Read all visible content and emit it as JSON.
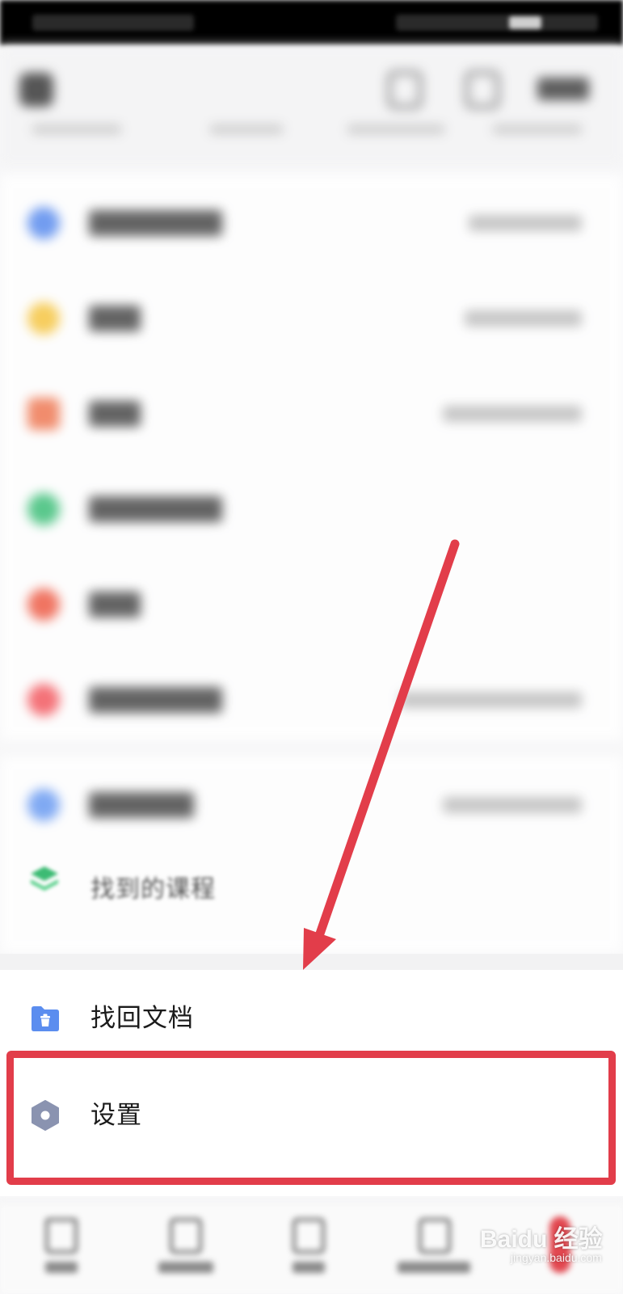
{
  "blurred_course_label": "找到的课程",
  "menu": {
    "items": [
      {
        "label": "找回文档",
        "icon": "folder-trash-icon"
      },
      {
        "label": "设置",
        "icon": "settings-hexagon-icon"
      }
    ]
  },
  "watermark": {
    "brand": "Baidu 经验",
    "sub": "jingyan.baidu.com"
  },
  "colors": {
    "highlight": "#e23d4a",
    "folder_icon": "#5b8def",
    "settings_icon": "#8a93b0"
  }
}
